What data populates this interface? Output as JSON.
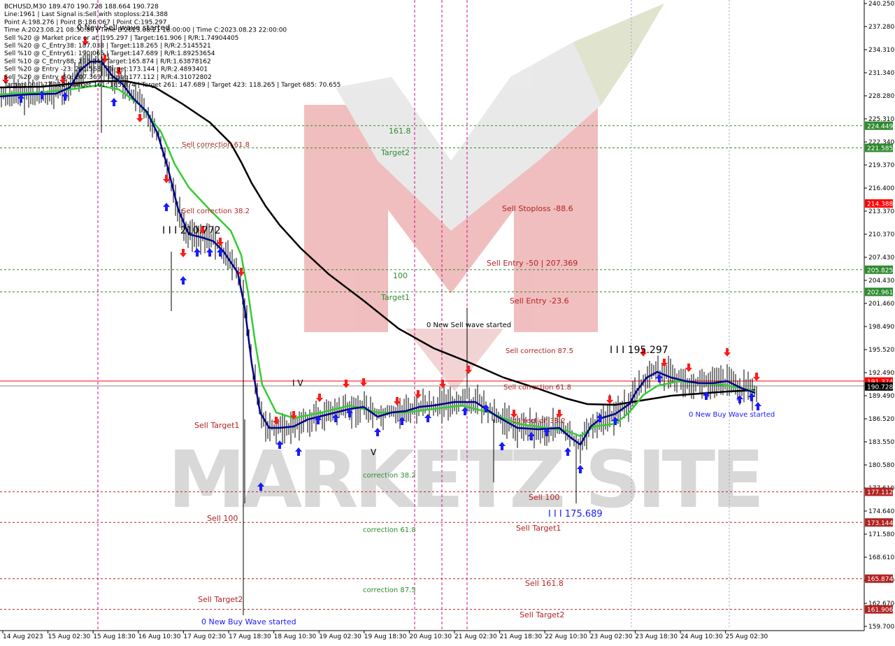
{
  "header": {
    "lines": [
      "BCHUSD,M30  189.470 190.728 188.664 190.728",
      "Line:1961 | Last Signal is:Sell with stoploss:214.388",
      "Point A:198.276 | Point B:186.067 | Point C:195.297",
      "Time A:2023.08.21 08:30:00 | Time B:2023.08.21 18:00:00 | Time C:2023.08.23 22:00:00",
      "Sell %20 @ Market price or at: 195.297 | Target:161.906 | R/R:1.74904405",
      "Sell %20 @ C_Entry38: 187.038 | Target:118.265 | R/R:2.5145521",
      "Sell %10 @ C_Entry61: 190.065 | Target:147.689 | R/R:1.89253654",
      "Sell %10 @ C_Entry88: 193.24 | Target:165.874 | R/R:1.63878162",
      "Sell %20 @ Entry -23: 201.568 | Target:173.144 | R/R:2.4893401",
      "Sell %20 @ Entry -50: 207.369 | Target:177.112 | R/R:4.31072802",
      "Target100: 177.112 | Target 161: 165.874 | Target 261: 147.689 | Target 423: 118.265 | Target 685: 70.655"
    ]
  },
  "colors": {
    "bg": "#ffffff",
    "wave_red": "#dc143c",
    "wave_blue": "#1a1aff",
    "ma_black": "#000000",
    "ma_green": "#32cd32",
    "ma_navy": "#00008b",
    "level_green": "#2e8b2e",
    "level_red": "#b22222",
    "price_line": "#ff0000",
    "vline_magenta": "#c71585",
    "vline_blue": "#9aa0c8"
  },
  "y_axis": {
    "ticks": [
      "240.250",
      "237.280",
      "234.310",
      "231.340",
      "228.280",
      "225.310",
      "222.340",
      "219.370",
      "216.400",
      "213.370",
      "210.370",
      "207.430",
      "204.430",
      "201.460",
      "198.490",
      "195.520",
      "192.490",
      "189.490",
      "186.520",
      "183.550",
      "180.580",
      "177.610",
      "174.640",
      "171.580",
      "168.610",
      "165.640",
      "162.670",
      "159.700"
    ],
    "range": [
      159.7,
      240.25
    ]
  },
  "x_axis": {
    "ticks": [
      "14 Aug 2023",
      "15 Aug 02:30",
      "15 Aug 18:30",
      "16 Aug 10:30",
      "17 Aug 02:30",
      "17 Aug 18:30",
      "18 Aug 10:30",
      "19 Aug 02:30",
      "19 Aug 18:30",
      "20 Aug 10:30",
      "21 Aug 02:30",
      "21 Aug 18:30",
      "22 Aug 10:30",
      "23 Aug 02:30",
      "23 Aug 18:30",
      "24 Aug 10:30",
      "25 Aug 02:30"
    ]
  },
  "price_badges": [
    {
      "value": "224.449",
      "kind": "green"
    },
    {
      "value": "221.585",
      "kind": "green"
    },
    {
      "value": "214.388",
      "kind": "red"
    },
    {
      "value": "205.825",
      "kind": "green"
    },
    {
      "value": "202.961",
      "kind": "green"
    },
    {
      "value": "191.374",
      "kind": "red"
    },
    {
      "value": "190.728",
      "kind": "black"
    },
    {
      "value": "177.112",
      "kind": "redline"
    },
    {
      "value": "173.144",
      "kind": "redline"
    },
    {
      "value": "165.874",
      "kind": "redline"
    },
    {
      "value": "161.906",
      "kind": "redline"
    }
  ],
  "labels": {
    "new_sell_wave_top": "0 New Sell wave started",
    "sell_corr_618_left": "Sell correction 61.8",
    "sell_corr_382_left": "Sell correction 38.2",
    "wave_mark_left": "I I I 210.772",
    "sell_target1_left": "Sell Target1",
    "sell_100_left": "Sell 100",
    "sell_target2_left": "Sell Target2",
    "new_buy_wave_bottom": "0 New Buy Wave started",
    "iv_mark": "I V",
    "v_mark": "V",
    "corr_382": "correction 38.2",
    "corr_618": "correction 61.8",
    "corr_875": "correction 87.5",
    "n1618": "161.8",
    "target2": "Target2",
    "n100": "100",
    "target1": "Target1",
    "new_sell_wave_mid": "0 New Sell wave started",
    "sell_stoploss": "Sell Stoploss -88.6",
    "sell_entry_50": "Sell Entry -50 | 207.369",
    "sell_entry_236": "Sell Entry -23.6",
    "sell_corr_875": "Sell correction 87.5",
    "sell_corr_618_mid": "Sell correction 61.8",
    "correction_mid": "correction 38.2",
    "sell_100_right": "Sell 100",
    "wave_mark_low": "I I I 175.689",
    "sell_target1_right": "Sell Target1",
    "sell_1618_right": "Sell 161.8",
    "sell_target2_right": "Sell Target2",
    "wave_mark_high": "I I I 195.297",
    "new_buy_wave_right": "0 New Buy Wave started",
    "watermark": "MARKETZ SITE"
  }
}
